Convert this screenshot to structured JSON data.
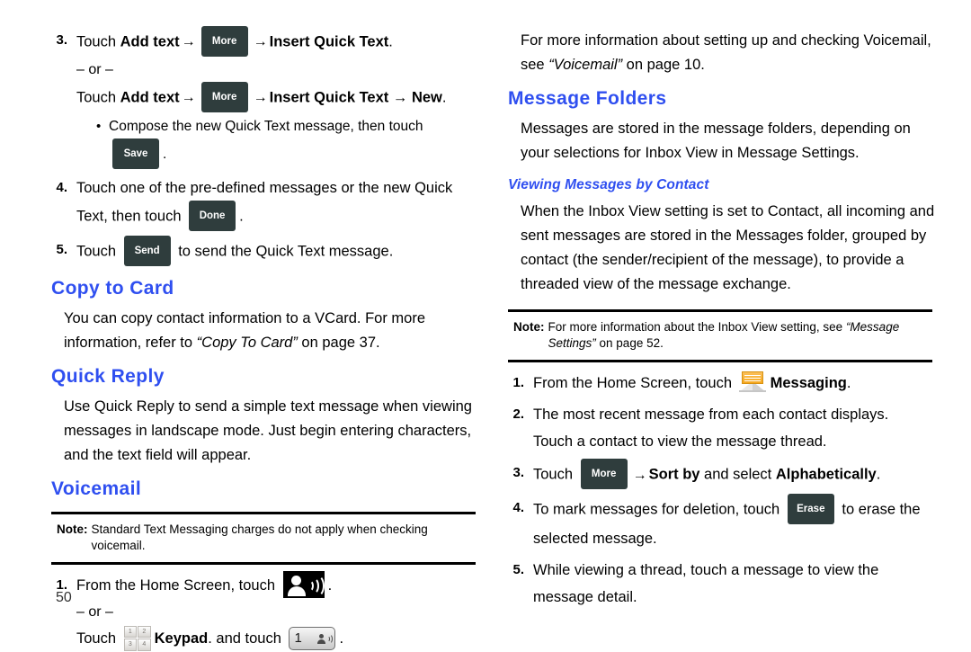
{
  "page": {
    "number": "50",
    "accent_color": "#2f4ff0",
    "key_button_color": "#2f3d3d"
  },
  "left_column": {
    "steps_top": [
      {
        "num": "3.",
        "lines": [
          {
            "pre": "Touch ",
            "bold1": "Add text",
            "arrow": "→",
            "key": "More",
            "arrow2": "→",
            "bold2": "Insert Quick Text",
            "post": "."
          },
          {
            "or": "– or –"
          },
          {
            "pre": "Touch ",
            "bold1": "Add text",
            "arrow": "→",
            "key": "More",
            "arrow2": "→",
            "bold2": "Insert Quick Text → New",
            "post": "."
          }
        ],
        "bullet": {
          "dot": "•",
          "pre": "Compose the new Quick Text message, then touch ",
          "key": "Save",
          "post": "."
        }
      },
      {
        "num": "4.",
        "line1": "Touch one of the pre-defined messages or the new Quick",
        "line2_pre": "Text, then touch ",
        "line2_key": "Done",
        "line2_post": "."
      },
      {
        "num": "5.",
        "pre": "Touch ",
        "key": "Send",
        "post": " to send the Quick Text message."
      }
    ],
    "copy_to_card": {
      "heading": "Copy to Card",
      "para_pre": "You can copy contact information to a VCard. For more information, refer to ",
      "para_italic": "“Copy To Card”",
      "para_post": " on page 37."
    },
    "quick_reply": {
      "heading": "Quick Reply",
      "para": "Use Quick Reply to send a simple text message when viewing messages in landscape mode. Just begin entering characters, and the text field will appear."
    },
    "voicemail": {
      "heading": "Voicemail",
      "note_label": "Note:",
      "note_text": "Standard Text Messaging charges do not apply when checking voicemail.",
      "step": {
        "num": "1.",
        "line1_pre": "From the Home Screen, touch ",
        "line1_icon": "voicemail-icon",
        "line1_post": ".",
        "or": "– or –",
        "line3_pre": "Touch ",
        "line3_icon": "keypad-icon",
        "line3_bold": "Keypad",
        "line3_mid": ". and touch ",
        "line3_icon2": "one-key-voicemail-icon",
        "line3_post": "."
      }
    }
  },
  "right_column": {
    "intro": {
      "pre": "For more information about setting up and checking Voicemail, see ",
      "italic": "“Voicemail”",
      "post": " on page 10."
    },
    "message_folders": {
      "heading": "Message Folders",
      "para": "Messages are stored in the message folders, depending on your selections for Inbox View in Message Settings."
    },
    "viewing_by_contact": {
      "heading": "Viewing Messages by Contact",
      "para": "When the Inbox View setting is set to Contact, all incoming and sent messages are stored in the Messages folder, grouped by contact (the sender/recipient of the message), to provide a threaded view of the message exchange.",
      "note_label": "Note:",
      "note_pre": "For more information about the Inbox View setting, see ",
      "note_italic": "“Message Settings”",
      "note_post": " on page 52.",
      "steps": [
        {
          "num": "1.",
          "pre": "From the Home Screen, touch ",
          "icon": "messaging-envelope-icon",
          "bold": "Messaging",
          "post": "."
        },
        {
          "num": "2.",
          "line1": "The most recent message from each contact displays.",
          "line2": "Touch a contact to view the message thread."
        },
        {
          "num": "3.",
          "pre": "Touch ",
          "key": "More",
          "arrow": "→",
          "bold1": "Sort by",
          "mid": " and select ",
          "bold2": "Alphabetically",
          "post": "."
        },
        {
          "num": "4.",
          "pre": "To mark messages for deletion, touch ",
          "key": "Erase",
          "post": " to erase the",
          "line2": "selected message."
        },
        {
          "num": "5.",
          "line1": "While viewing a thread, touch a message to view the",
          "line2": "message detail."
        }
      ]
    },
    "keypad_icon_digits": [
      "1",
      "2",
      "3",
      "4"
    ],
    "one_key_label": "1"
  }
}
